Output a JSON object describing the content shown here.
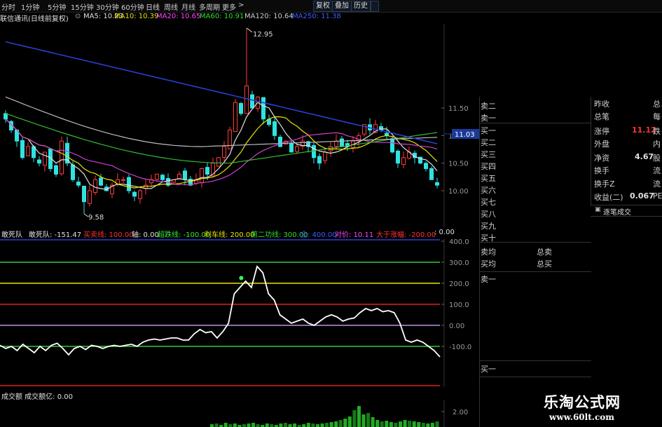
{
  "toolbar": {
    "items": [
      "分时",
      "1分钟",
      "5分钟",
      "15分钟",
      "30分钟",
      "60分钟",
      "日线",
      "周线",
      "月线",
      "多周期",
      "更多"
    ],
    "arrow": ">",
    "buttons": [
      "复权",
      "叠加",
      "历史"
    ]
  },
  "stock": {
    "title": "联信通讯(日线前复权)",
    "ma": [
      {
        "label": "MA5: 10.23",
        "color": "#e0e0e0"
      },
      {
        "label": "MA10: 10.39",
        "color": "#e6e600"
      },
      {
        "label": "MA20: 10.65",
        "color": "#ff44ff"
      },
      {
        "label": "MA60: 10.91",
        "color": "#33dd33"
      },
      {
        "label": "MA120: 10.64",
        "color": "#d0d0d0"
      },
      {
        "label": "MA250: 11.38",
        "color": "#3a5cff"
      }
    ]
  },
  "main_chart": {
    "price_axis": [
      "11.50",
      "11.00",
      "10.50",
      "10.00"
    ],
    "current_price": "11.03",
    "high_label": "12.95",
    "low_label": "9.58"
  },
  "indicator": {
    "name": "敢死队",
    "values": [
      {
        "label": "敢死队: -151.47",
        "color": "#e0e0e0"
      },
      {
        "label": "买卖线: 100.00",
        "color": "#ff3333"
      },
      {
        "label": "轴: 0.00",
        "color": "#e0e0e0"
      },
      {
        "label": "超跌线: -100.00",
        "color": "#33ee33"
      },
      {
        "label": "利车线: 200.00",
        "color": "#e6e600"
      },
      {
        "label": "第二功线: 300.00",
        "color": "#33dd33"
      },
      {
        "label": "全: 400.00",
        "color": "#3a5cff"
      },
      {
        "label": "对价: 10.11",
        "color": "#ff44ff"
      },
      {
        "label": "大于涨幅: -200.00",
        "color": "#ff3333"
      },
      {
        "label": ": 0.00",
        "color": "#e0e0e0"
      }
    ],
    "axis": [
      "400.0",
      "300.0",
      "200.0",
      "100.0",
      "0.00",
      "-100.0"
    ]
  },
  "volume": {
    "label": "成交额 成交额亿: 0.00",
    "axis": "2.00"
  },
  "order_book": {
    "asks_top": [
      "卖二",
      "卖一"
    ],
    "bids": [
      "买一",
      "买二",
      "买三",
      "买四",
      "买五",
      "买六",
      "买七",
      "买八",
      "买九",
      "买十"
    ],
    "avg": [
      "卖均",
      "买均"
    ],
    "totals": [
      "总卖",
      "总买"
    ],
    "ask_row": "卖一",
    "bottom_bid": "买一"
  },
  "right_panel": {
    "rows": [
      {
        "label": "昨收",
        "right": "总"
      },
      {
        "label": "总笔",
        "right": "每"
      },
      {
        "label": "涨停",
        "value": "11.12",
        "right": "跌"
      },
      {
        "label": "外盘",
        "right": "内"
      },
      {
        "label": "净资",
        "value": "4.67",
        "right": "股"
      },
      {
        "label": "换手",
        "right": "流"
      },
      {
        "label": "换手Z",
        "right": "流"
      },
      {
        "label": "收益(二)",
        "value": "0.067",
        "right": "PE"
      }
    ],
    "trade_header": "逐笔成交",
    "value_color": "#ff3333"
  },
  "watermark": {
    "cn": "乐淘公式网",
    "url": "www.60lt.com"
  }
}
